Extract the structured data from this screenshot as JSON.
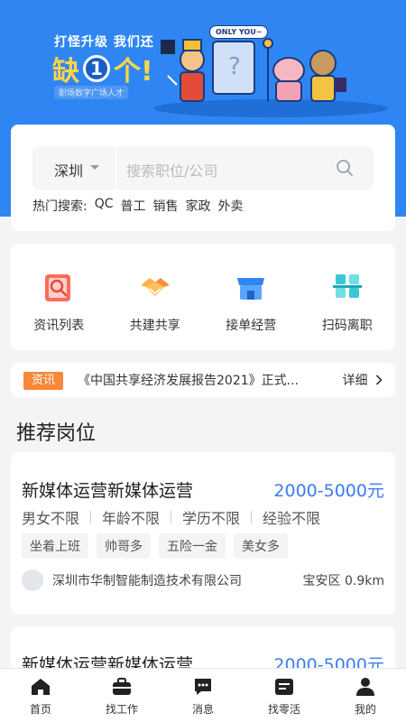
{
  "banner": {
    "slogan_line1": "打怪升级 我们还",
    "slogan_big_prefix": "缺",
    "slogan_big_number": "1",
    "slogan_big_suffix": "个!",
    "tagline": "职场数字广场人才",
    "bubble": "ONLY YOU~"
  },
  "search": {
    "city": "深圳",
    "placeholder": "搜索职位/公司",
    "hot_label": "热门搜索:",
    "hot_keywords": [
      "QC",
      "普工",
      "销售",
      "家政",
      "外卖"
    ]
  },
  "menu": {
    "items": [
      {
        "label": "资讯列表",
        "icon": "news-list-icon"
      },
      {
        "label": "共建共享",
        "icon": "handshake-icon"
      },
      {
        "label": "接单经营",
        "icon": "store-icon"
      },
      {
        "label": "扫码离职",
        "icon": "scan-icon"
      }
    ]
  },
  "news": {
    "badge": "资讯",
    "text": "《中国共享经济发展报告2021》正式...",
    "more": "详细"
  },
  "section": {
    "title": "推荐岗位"
  },
  "jobs": [
    {
      "title": "新媒体运营新媒体运营",
      "salary": "2000-5000元",
      "requirements": [
        "男女不限",
        "年龄不限",
        "学历不限",
        "经验不限"
      ],
      "tags": [
        "坐着上班",
        "帅哥多",
        "五险一金",
        "美女多"
      ],
      "company": "深圳市华制智能制造技术有限公司",
      "distance": "宝安区 0.9km"
    },
    {
      "title": "新媒体运营新媒体运营",
      "salary": "2000-5000元"
    }
  ],
  "tabbar": {
    "items": [
      {
        "label": "首页",
        "icon": "home-icon"
      },
      {
        "label": "找工作",
        "icon": "briefcase-icon"
      },
      {
        "label": "消息",
        "icon": "message-icon"
      },
      {
        "label": "找零活",
        "icon": "id-card-icon"
      },
      {
        "label": "我的",
        "icon": "user-icon"
      }
    ]
  },
  "colors": {
    "brand_blue": "#2f86f2",
    "salary_blue": "#3b7cf3",
    "news_badge_orange": "#f7883a"
  }
}
